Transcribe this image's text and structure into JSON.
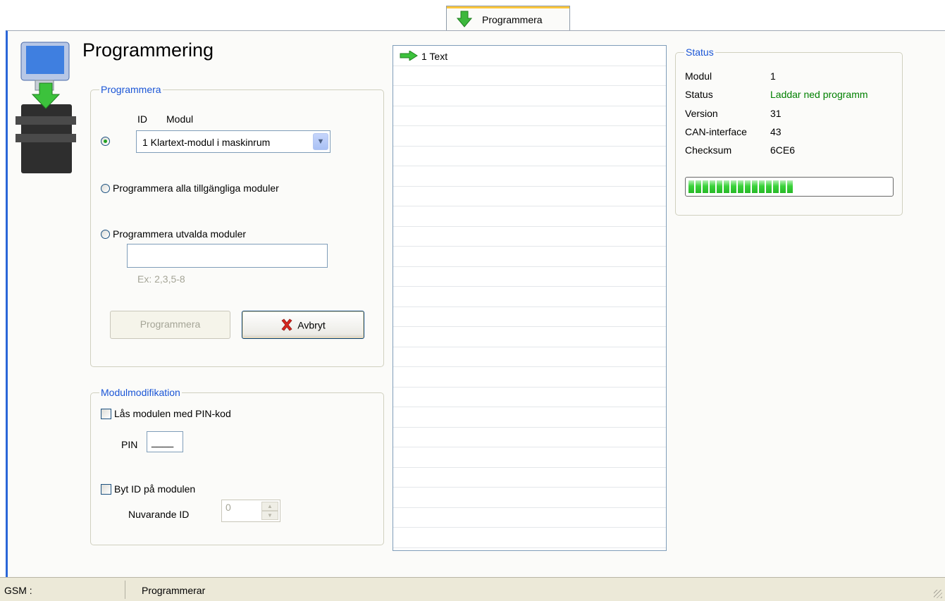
{
  "tab": {
    "label": "Programmera"
  },
  "page": {
    "title": "Programmering"
  },
  "program_group": {
    "legend": "Programmera",
    "id_header": "ID",
    "modul_header": "Modul",
    "module_select_value": "1 Klartext-modul  i maskinrum",
    "radio_single_selected": true,
    "radio_all_label": "Programmera alla tillgängliga moduler",
    "radio_selected_label": "Programmera utvalda moduler",
    "selected_modules_value": "",
    "example_hint": "Ex: 2,3,5-8",
    "program_button": "Programmera",
    "cancel_button": "Avbryt"
  },
  "modmod_group": {
    "legend": "Modulmodifikation",
    "lock_label": "Lås modulen med PIN-kod",
    "lock_checked": false,
    "pin_label": "PIN",
    "pin_value": "____",
    "change_id_label": "Byt ID på modulen",
    "change_id_checked": false,
    "current_id_label": "Nuvarande ID",
    "current_id_value": "0"
  },
  "log_list": {
    "items": [
      {
        "icon": "green-arrow-icon",
        "text": "1  Text"
      }
    ],
    "empty_rows": 24
  },
  "status_group": {
    "legend": "Status",
    "rows": [
      {
        "key": "Modul",
        "value": "1"
      },
      {
        "key": "Status",
        "value": "Laddar ned programm"
      },
      {
        "key": "Version",
        "value": "31"
      },
      {
        "key": "CAN-interface",
        "value": "43"
      },
      {
        "key": "Checksum",
        "value": "6CE6"
      }
    ],
    "status_value_color": "#008000",
    "progress_fraction": 0.55
  },
  "statusbar": {
    "gsm_label": "GSM :",
    "message": "Programmerar"
  },
  "colors": {
    "accent": "#2a66d8",
    "legend_blue": "#1a55d6",
    "progress_green": "#3ad33a"
  }
}
